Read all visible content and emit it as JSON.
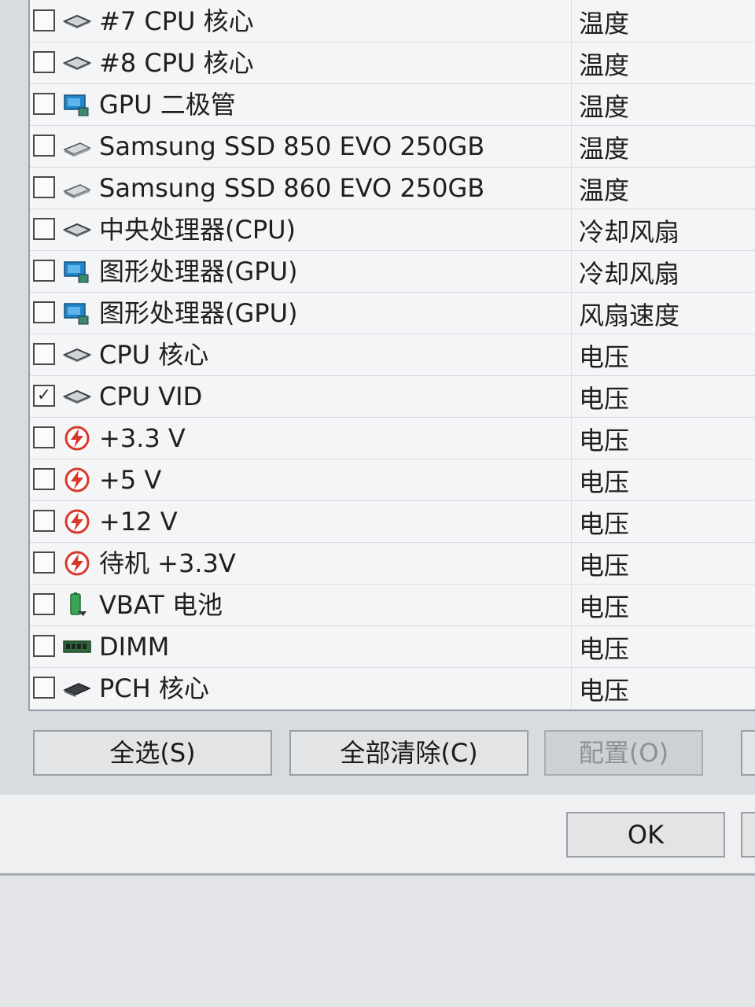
{
  "sensors": [
    {
      "name": "#7 CPU 核心",
      "type": "温度",
      "icon": "cpu-chip-icon",
      "checked": false
    },
    {
      "name": "#8 CPU 核心",
      "type": "温度",
      "icon": "cpu-chip-icon",
      "checked": false
    },
    {
      "name": "GPU 二极管",
      "type": "温度",
      "icon": "gpu-card-icon",
      "checked": false
    },
    {
      "name": "Samsung SSD 850 EVO 250GB",
      "type": "温度",
      "icon": "ssd-drive-icon",
      "checked": false
    },
    {
      "name": "Samsung SSD 860 EVO 250GB",
      "type": "温度",
      "icon": "ssd-drive-icon",
      "checked": false
    },
    {
      "name": "中央处理器(CPU)",
      "type": "冷却风扇",
      "icon": "cpu-chip-icon",
      "checked": false
    },
    {
      "name": "图形处理器(GPU)",
      "type": "冷却风扇",
      "icon": "gpu-card-icon",
      "checked": false
    },
    {
      "name": "图形处理器(GPU)",
      "type": "风扇速度",
      "icon": "gpu-card-icon",
      "checked": false
    },
    {
      "name": "CPU 核心",
      "type": "电压",
      "icon": "cpu-chip-icon",
      "checked": false
    },
    {
      "name": "CPU VID",
      "type": "电压",
      "icon": "cpu-chip-icon",
      "checked": true
    },
    {
      "name": "+3.3 V",
      "type": "电压",
      "icon": "lightning-bolt-icon",
      "checked": false
    },
    {
      "name": "+5 V",
      "type": "电压",
      "icon": "lightning-bolt-icon",
      "checked": false
    },
    {
      "name": "+12 V",
      "type": "电压",
      "icon": "lightning-bolt-icon",
      "checked": false
    },
    {
      "name": "待机 +3.3V",
      "type": "电压",
      "icon": "lightning-bolt-icon",
      "checked": false
    },
    {
      "name": "VBAT 电池",
      "type": "电压",
      "icon": "battery-icon",
      "checked": false
    },
    {
      "name": "DIMM",
      "type": "电压",
      "icon": "memory-module-icon",
      "checked": false
    },
    {
      "name": "PCH 核心",
      "type": "电压",
      "icon": "chipset-icon",
      "checked": false
    }
  ],
  "buttons": {
    "select_all": "全选(S)",
    "clear_all": "全部清除(C)",
    "configure": "配置(O)",
    "ok": "OK"
  },
  "colors": {
    "accent_blue": "#1f86c9",
    "bolt_red": "#d9382b",
    "battery_green": "#3aa655"
  }
}
